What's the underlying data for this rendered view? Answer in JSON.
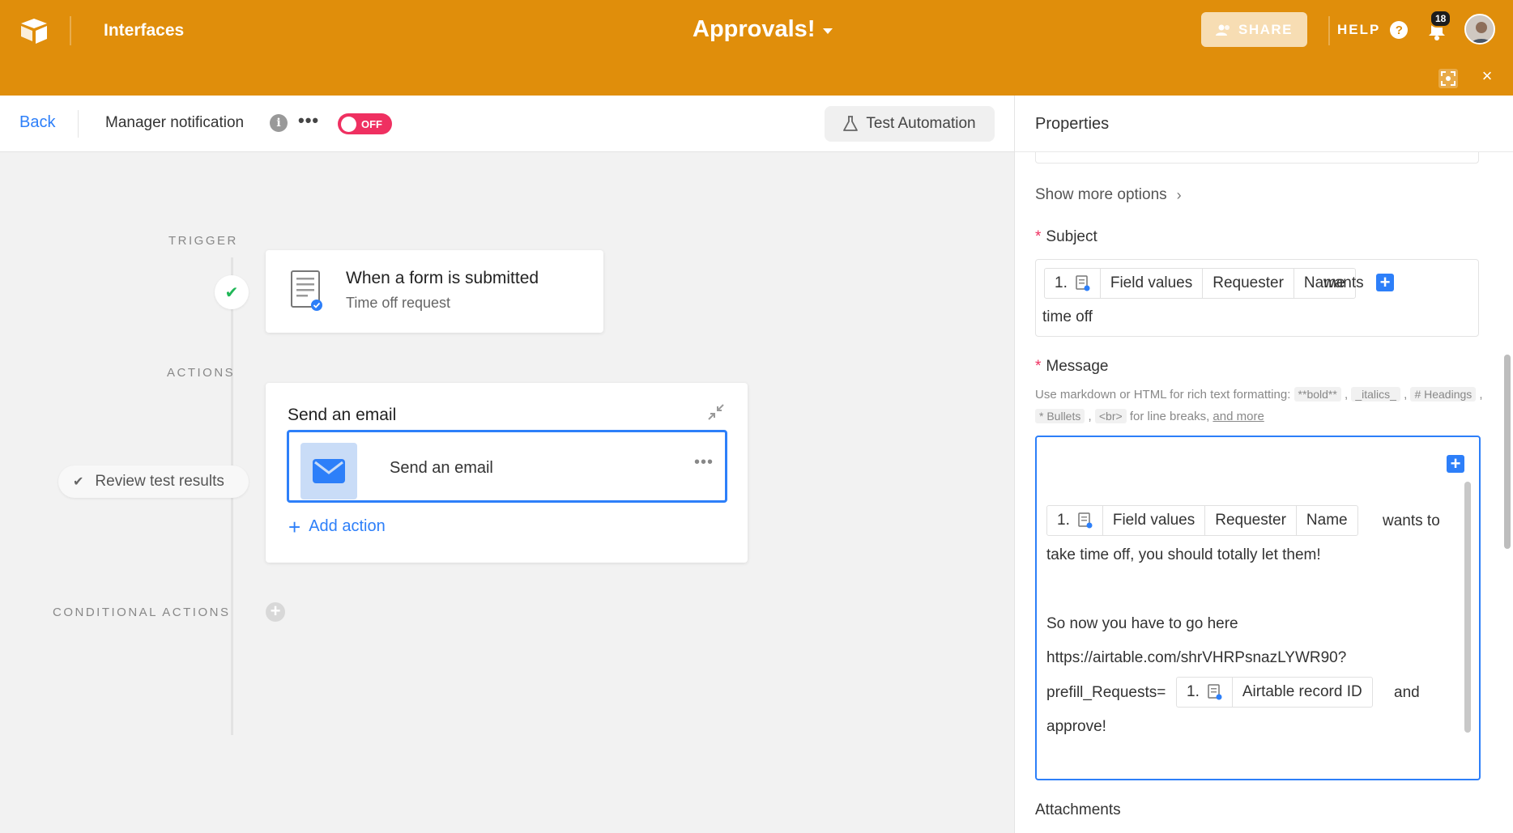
{
  "topbar": {
    "section": "Interfaces",
    "base_name": "Approvals!",
    "share_label": "SHARE",
    "help_label": "HELP",
    "notification_count": "18",
    "accent": "#e08e0b"
  },
  "header": {
    "back_label": "Back",
    "automation_name": "Manager notification",
    "toggle_label": "OFF",
    "test_label": "Test Automation"
  },
  "canvas": {
    "trigger_label": "TRIGGER",
    "actions_label": "ACTIONS",
    "conditional_label": "CONDITIONAL ACTIONS",
    "trigger_title": "When a form is submitted",
    "trigger_subtitle": "Time off request",
    "review_label": "Review test results",
    "action_card_title": "Send an email",
    "action_step_label": "Send an email",
    "add_action_label": "Add action"
  },
  "panel": {
    "title": "Properties",
    "show_more": "Show more options",
    "subject_label": "Subject",
    "subject": {
      "token_num": "1.",
      "token_parts": [
        "Field values",
        "Requester",
        "Name"
      ],
      "text_after": "wants",
      "line2": "time off"
    },
    "message_label": "Message",
    "hint": {
      "prefix": "Use markdown or HTML for rich text formatting:",
      "bold": "**bold**",
      "italics": "_italics_",
      "headings": "# Headings",
      "bullets": "* Bullets",
      "br": "<br>",
      "br_suffix": "for line breaks,",
      "more_link": "and more"
    },
    "message": {
      "token_num": "1.",
      "token_parts": [
        "Field values",
        "Requester",
        "Name"
      ],
      "text_after": "wants to",
      "line2": "take time off, you should totally let them!",
      "line3": "So now you have to go here",
      "line4": "https://airtable.com/shrVHRPsnazLYWR90?",
      "line5_prefix": "prefill_Requests=",
      "token2_num": "1.",
      "token2_label": "Airtable record ID",
      "line5_suffix": "and",
      "line6": "approve!"
    },
    "attachments_label": "Attachments"
  }
}
